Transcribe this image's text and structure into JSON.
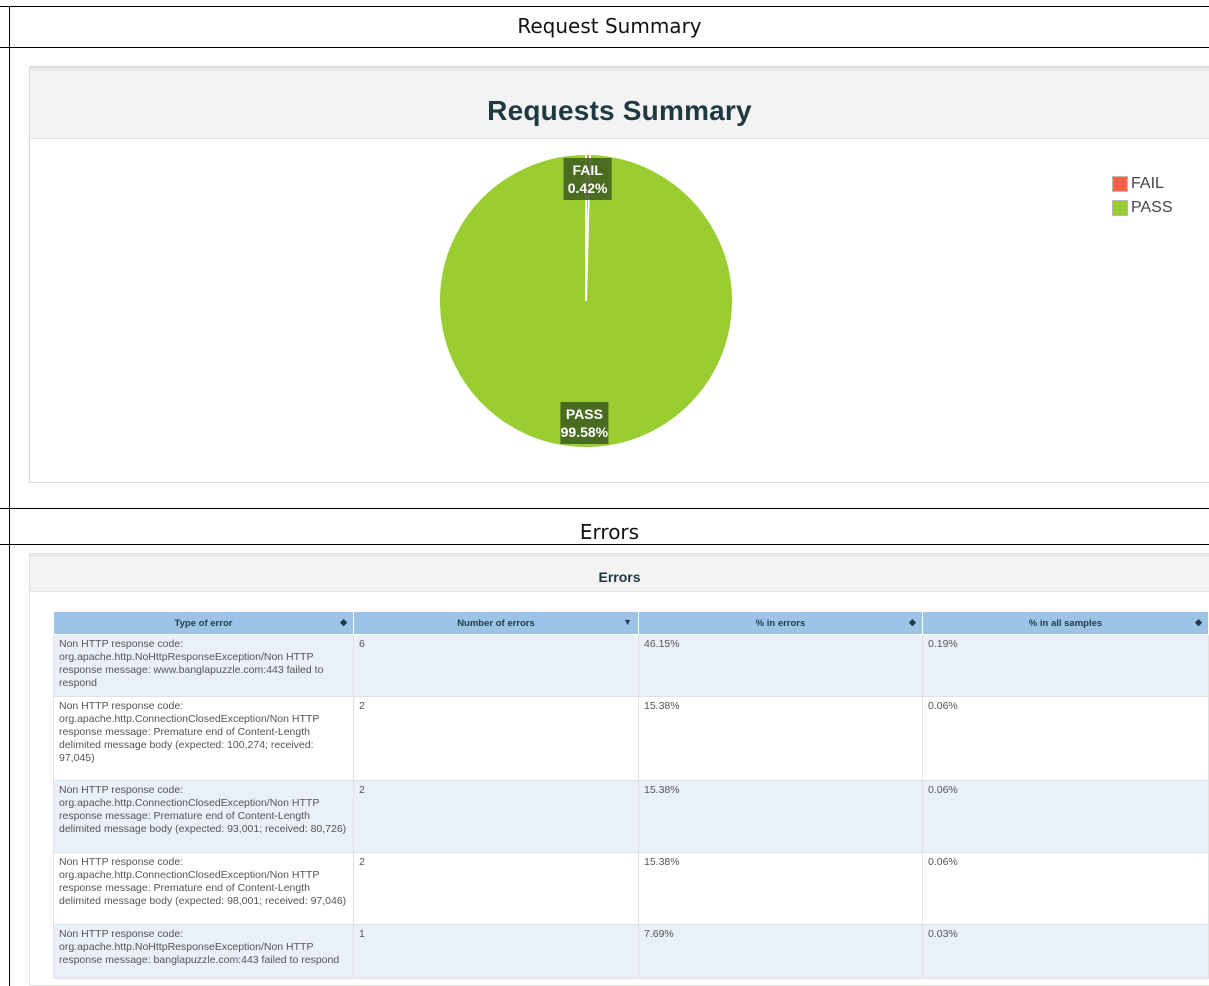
{
  "captions": {
    "request_summary": "Request Summary",
    "errors": "Errors"
  },
  "summary_panel": {
    "title": "Requests Summary",
    "legend": [
      {
        "label": "FAIL",
        "color": "#ff6347"
      },
      {
        "label": "PASS",
        "color": "#9acd32"
      }
    ]
  },
  "chart_data": {
    "type": "pie",
    "title": "Requests Summary",
    "slices": [
      {
        "label": "FAIL",
        "value": 0.42,
        "display": "0.42%",
        "color": "#ff6347"
      },
      {
        "label": "PASS",
        "value": 99.58,
        "display": "99.58%",
        "color": "#9acd32"
      }
    ],
    "legend_position": "top-right"
  },
  "errors_panel": {
    "title": "Errors",
    "columns": [
      "Type of error",
      "Number of errors",
      "% in errors",
      "% in all samples"
    ],
    "sort_icons": [
      "sort-icon",
      "sort-desc-icon",
      "sort-icon",
      "sort-icon"
    ],
    "rows": [
      {
        "type": "Non HTTP response code: org.apache.http.NoHttpResponseException/Non HTTP response message: www.banglapuzzle.com:443 failed to respond",
        "count": "6",
        "pct_errors": "46.15%",
        "pct_samples": "0.19%"
      },
      {
        "type": "Non HTTP response code: org.apache.http.ConnectionClosedException/Non HTTP response message: Premature end of Content-Length delimited message body (expected: 100,274; received: 97,045)",
        "count": "2",
        "pct_errors": "15.38%",
        "pct_samples": "0.06%"
      },
      {
        "type": "Non HTTP response code: org.apache.http.ConnectionClosedException/Non HTTP response message: Premature end of Content-Length delimited message body (expected: 93,001; received: 80,726)",
        "count": "2",
        "pct_errors": "15.38%",
        "pct_samples": "0.06%"
      },
      {
        "type": "Non HTTP response code: org.apache.http.ConnectionClosedException/Non HTTP response message: Premature end of Content-Length delimited message body (expected: 98,001; received: 97,046)",
        "count": "2",
        "pct_errors": "15.38%",
        "pct_samples": "0.06%"
      },
      {
        "type": "Non HTTP response code: org.apache.http.NoHttpResponseException/Non HTTP response message: banglapuzzle.com:443 failed to respond",
        "count": "1",
        "pct_errors": "7.69%",
        "pct_samples": "0.03%"
      }
    ]
  }
}
